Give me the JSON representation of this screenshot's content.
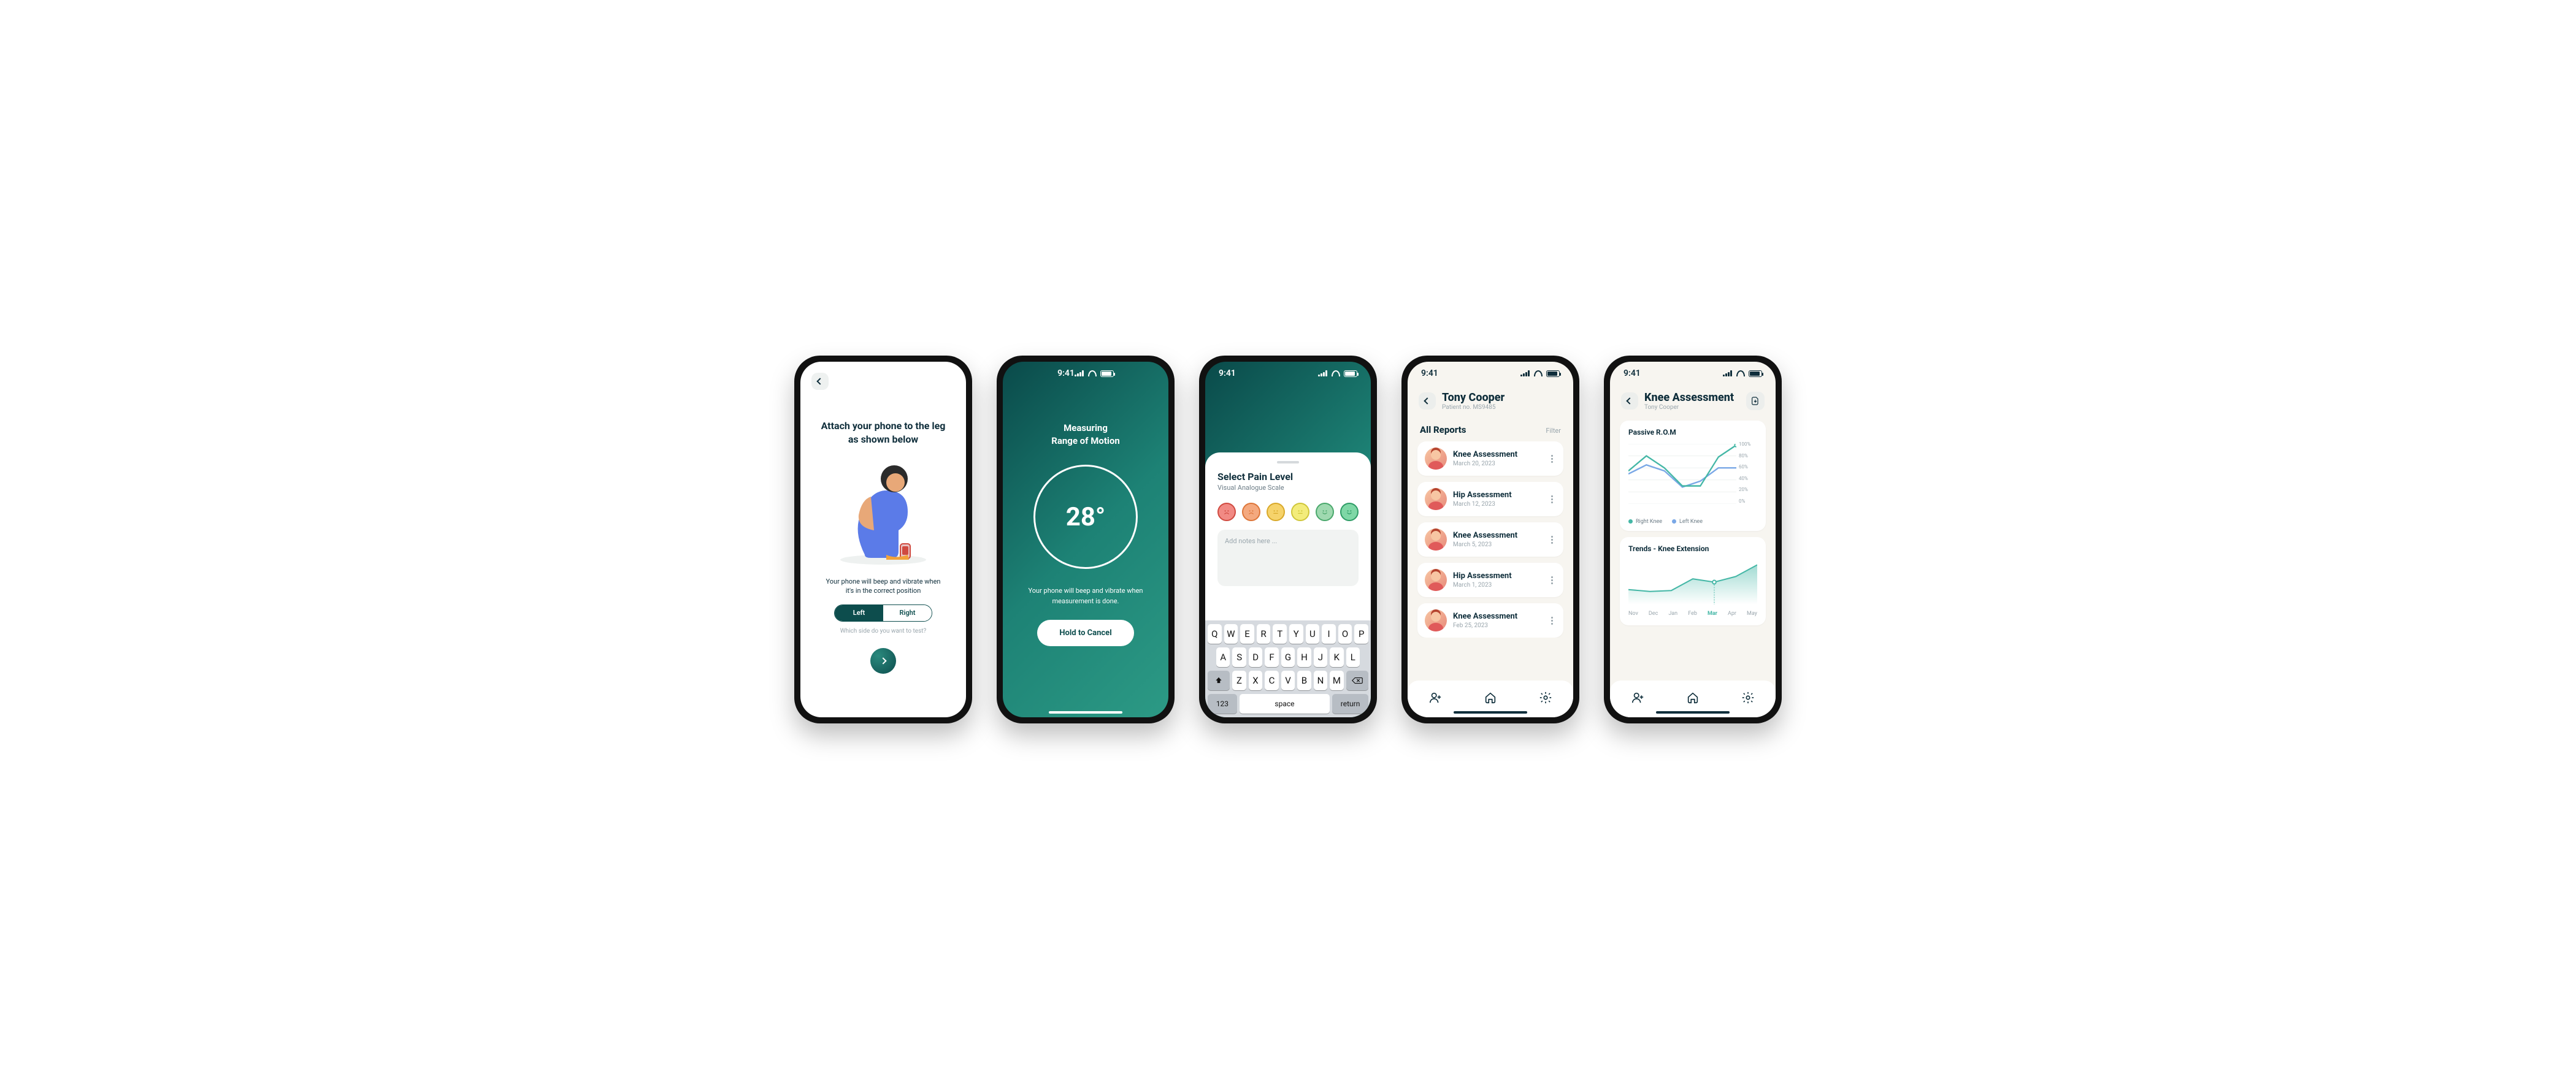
{
  "status_time": "9:41",
  "screen1": {
    "heading": "Attach your phone to the leg as shown below",
    "hint": "Your phone will beep and vibrate when it's in the correct position",
    "seg_left": "Left",
    "seg_right": "Right",
    "question": "Which side do you want to test?"
  },
  "screen2": {
    "title_l1": "Measuring",
    "title_l2": "Range of Motion",
    "value": "28°",
    "hint": "Your phone will beep and vibrate when measurement is done.",
    "cancel": "Hold to Cancel"
  },
  "screen3": {
    "title": "Select Pain Level",
    "subtitle": "Visual Analogue Scale",
    "notes_placeholder": "Add notes here ...",
    "faces": [
      {
        "bg": "#f18a84",
        "ring": "#d04a40"
      },
      {
        "bg": "#f4a97f",
        "ring": "#dd763a"
      },
      {
        "bg": "#f6d36b",
        "ring": "#d9a92a"
      },
      {
        "bg": "#f3ec7b",
        "ring": "#cfc63a"
      },
      {
        "bg": "#9fd9b0",
        "ring": "#4aa86c"
      },
      {
        "bg": "#7fd7a6",
        "ring": "#2e9c66"
      }
    ],
    "keys_r1": [
      "Q",
      "W",
      "E",
      "R",
      "T",
      "Y",
      "U",
      "I",
      "O",
      "P"
    ],
    "keys_r2": [
      "A",
      "S",
      "D",
      "F",
      "G",
      "H",
      "J",
      "K",
      "L"
    ],
    "keys_r3": [
      "Z",
      "X",
      "C",
      "V",
      "B",
      "N",
      "M"
    ],
    "k_123": "123",
    "k_space": "space",
    "k_return": "return"
  },
  "screen4": {
    "name": "Tony Cooper",
    "patient_no": "Patient no. MS9485",
    "section": "All Reports",
    "filter": "Filter",
    "reports": [
      {
        "title": "Knee Assessment",
        "date": "March 20, 2023"
      },
      {
        "title": "Hip Assessment",
        "date": "March 12, 2023"
      },
      {
        "title": "Knee Assessment",
        "date": "March 5, 2023"
      },
      {
        "title": "Hip Assessment",
        "date": "March 1, 2023"
      },
      {
        "title": "Knee Assessment",
        "date": "Feb 25, 2023"
      }
    ]
  },
  "screen5": {
    "title": "Knee Assessment",
    "subtitle": "Tony Cooper",
    "chart1_title": "Passive R.O.M",
    "legend_right": "Right Knee",
    "legend_left": "Left Knee",
    "chart2_title": "Trends - Knee Extension",
    "months": [
      "Nov",
      "Dec",
      "Jan",
      "Feb",
      "Mar",
      "Apr",
      "May"
    ],
    "current_month": "Mar"
  },
  "chart_data": [
    {
      "type": "line",
      "title": "Passive R.O.M",
      "ylabel": "%",
      "ylim": [
        0,
        100
      ],
      "yticks": [
        0,
        20,
        40,
        60,
        80,
        100
      ],
      "x_count": 7,
      "series": [
        {
          "name": "Right Knee",
          "color": "#44b7a6",
          "values": [
            55,
            80,
            60,
            30,
            30,
            78,
            98
          ]
        },
        {
          "name": "Left Knee",
          "color": "#7aa8e6",
          "values": [
            50,
            65,
            55,
            28,
            38,
            60,
            60
          ]
        }
      ]
    },
    {
      "type": "area",
      "title": "Trends - Knee Extension",
      "categories": [
        "Nov",
        "Dec",
        "Jan",
        "Feb",
        "Mar",
        "Apr",
        "May"
      ],
      "values": [
        32,
        28,
        30,
        55,
        48,
        60,
        85
      ],
      "current": "Mar",
      "ylim": [
        0,
        100
      ]
    }
  ]
}
